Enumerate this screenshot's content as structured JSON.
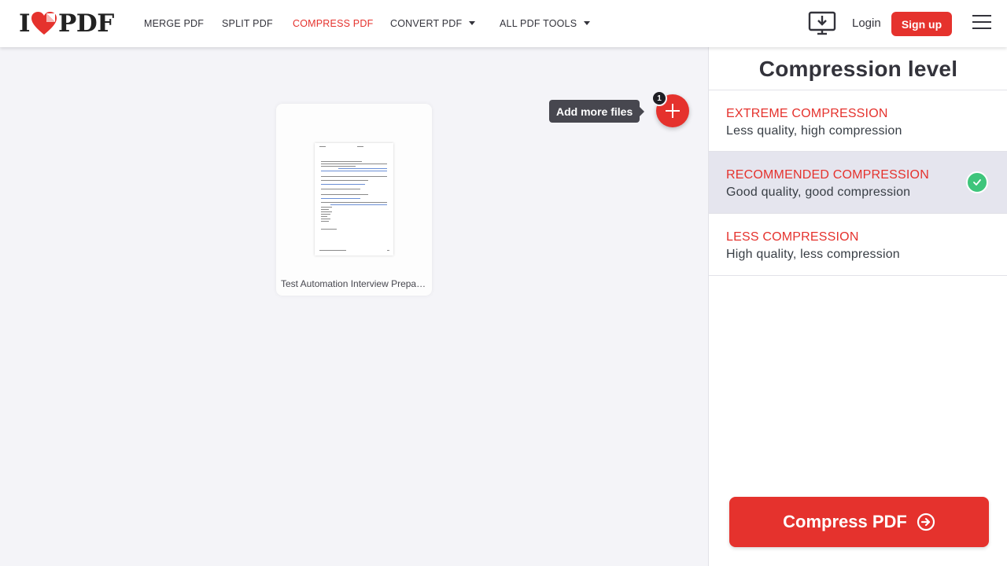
{
  "brand": {
    "logo_left": "I",
    "logo_right": "PDF",
    "accent": "#e5322d"
  },
  "nav": {
    "items": [
      {
        "label": "MERGE PDF"
      },
      {
        "label": "SPLIT PDF"
      },
      {
        "label": "COMPRESS PDF",
        "active": true
      },
      {
        "label": "CONVERT PDF",
        "dropdown": true
      },
      {
        "label": "ALL PDF TOOLS",
        "dropdown": true
      }
    ],
    "desktop_icon": "desktop-download-icon",
    "login": "Login",
    "signup": "Sign up",
    "menu_icon": "hamburger-menu-icon"
  },
  "workspace": {
    "files": [
      {
        "name": "Test Automation Interview Preparation.pdf"
      }
    ],
    "add_files_tooltip": "Add more files",
    "file_count": "1"
  },
  "sidebar": {
    "title": "Compression level",
    "options": [
      {
        "title": "EXTREME COMPRESSION",
        "desc": "Less quality, high compression",
        "selected": false
      },
      {
        "title": "RECOMMENDED COMPRESSION",
        "desc": "Good quality, good compression",
        "selected": true
      },
      {
        "title": "LESS COMPRESSION",
        "desc": "High quality, less compression",
        "selected": false
      }
    ],
    "action_label": "Compress PDF",
    "colors": {
      "check": "#3ec57b",
      "selected_bg": "#e5e5ee"
    }
  }
}
